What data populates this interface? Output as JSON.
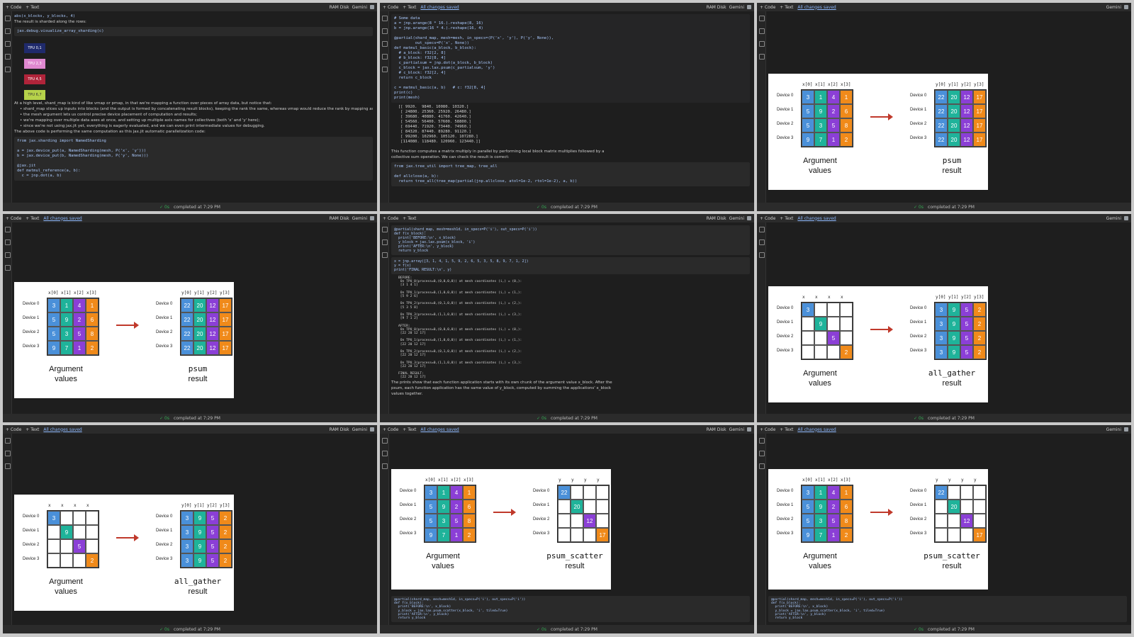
{
  "colors": {
    "blue": "#4a90d9",
    "teal": "#1fb39a",
    "purple": "#8b3fd6",
    "orange": "#f08a1a",
    "arrow": "#c0392b"
  },
  "common": {
    "tab_code": "+ Code",
    "tab_text": "+ Text",
    "link_label": "All changes saved",
    "ram_label": "RAM Disk",
    "gemini_label": "Gemini",
    "status": "completed at 7:29 PM",
    "status_ok": "✓ 0s"
  },
  "device_labels": [
    "Device 0",
    "Device 1",
    "Device 2",
    "Device 3"
  ],
  "x_cols": [
    "x[0]",
    "x[1]",
    "x[2]",
    "x[3]"
  ],
  "y_cols": [
    "y[0]",
    "y[1]",
    "y[2]",
    "y[3]"
  ],
  "x_plain": [
    "x",
    "x",
    "x",
    "x"
  ],
  "y_plain": [
    "y",
    "y",
    "y",
    "y"
  ],
  "arg_matrix": [
    [
      "3",
      "1",
      "4",
      "1"
    ],
    [
      "5",
      "9",
      "2",
      "6"
    ],
    [
      "5",
      "3",
      "5",
      "8"
    ],
    [
      "9",
      "7",
      "1",
      "2"
    ]
  ],
  "psum_matrix": [
    [
      "22",
      "20",
      "12",
      "17"
    ],
    [
      "22",
      "20",
      "12",
      "17"
    ],
    [
      "22",
      "20",
      "12",
      "17"
    ],
    [
      "22",
      "20",
      "12",
      "17"
    ]
  ],
  "gather_arg": [
    [
      "3",
      "",
      "",
      ""
    ],
    [
      "",
      "9",
      "",
      ""
    ],
    [
      "",
      "",
      "5",
      ""
    ],
    [
      "",
      "",
      "",
      "2"
    ]
  ],
  "gather_res": [
    [
      "3",
      "9",
      "5",
      "2"
    ],
    [
      "3",
      "9",
      "5",
      "2"
    ],
    [
      "3",
      "9",
      "5",
      "2"
    ],
    [
      "3",
      "9",
      "5",
      "2"
    ]
  ],
  "scatter_res": [
    [
      "22",
      "",
      "",
      ""
    ],
    [
      "",
      "20",
      "",
      ""
    ],
    [
      "",
      "",
      "12",
      ""
    ],
    [
      "",
      "",
      "",
      "17"
    ]
  ],
  "captions": {
    "argument": "Argument values",
    "psum": "psum result",
    "all_gather": "all_gather result",
    "psum_scatter": "psum_scatter result"
  },
  "panels": {
    "p1": {
      "lines": [
        "abs(x_blocks, y_blocks, 4)",
        "The result is sharded along the rows:",
        "jax.debug.visualize_array_sharding(c)",
        "At a high level, shard_map is kind of like vmap or pmap, in that we're mapping a function over pieces of array data, but notice that:",
        "• shard_map slices up inputs into blocks (and the output is formed by concatenating result blocks), keeping the rank the same, whereas vmap would reduce the rank by mapping away an axis;",
        "• the mesh argument lets us control precise device placement of computation and results;",
        "• we're mapping over multiple data axes at once, and setting up multiple axis names for collectives (both 'x' and 'y' here);",
        "• since we're not using jax.jit yet, everything is eagerly evaluated, and we can even print intermediate values for debugging.",
        "The above code is performing the same computation as this jax.jit automatic parallelization code:"
      ],
      "tpus": [
        "TPU 0,1",
        "TPU 2,3",
        "TPU 4,5",
        "TPU 6,7"
      ],
      "code": "from jax.sharding import NamedSharding\n\na = jax.device_put(a, NamedSharding(mesh, P('x', 'y')))\nb = jax.device_put(b, NamedSharding(mesh, P('y', None)))\n\n@jax.jit\ndef matmul_reference(a, b):\n  c = jnp.dot(a, b)"
    },
    "p2": {
      "code": "# Some data\na = jnp.arange(8 * 16.).reshape(8, 16)\nb = jnp.arange(16 * 4.).reshape(16, 4)\n\n@partial(shard_map, mesh=mesh, in_specs=(P('x', 'y'), P('y', None)),\n         out_specs=P('x', None))\ndef matmul_basic(a_block, b_block):\n  # a_block: f32[2, 8]\n  # b_block: f32[8, 4]\n  c_partialsum = jnp.dot(a_block, b_block)\n  c_block = jax.lax.psum(c_partialsum, 'y')\n  # c_block: f32[2, 4]\n  return c_block\n\nc = matmul_basic(a, b)   # c: f32[8, 4]\nprint(c)\nprint(mesh)",
      "output": "[[ 9920.  9840. 10080. 10320.]\n [ 24800. 25360. 25920. 26480.]\n [ 39680. 40880. 41760. 42640.]\n [ 54560. 56400. 57600. 58800.]\n [ 69440. 71920. 73440. 74960.]\n [ 84320. 87440. 89280. 91120.]\n [ 99200. 102960. 105120. 107280.]\n [114080. 118480. 120960. 123440.]]",
      "lines": [
        "This function computes a matrix multiply in parallel by performing local block matrix multiplies followed by a collective sum operation. We can check the result is correct:"
      ],
      "code2": "from jax.tree_util import tree_map, tree_all\n\ndef allclose(a, b):\n  return tree_all(tree_map(partial(jnp.allclose, atol=1e-2, rtol=1e-2), a, b))"
    },
    "psum_text": [
      "Notice that collective_sum might depend on all the x_blocks. That is, while f_sum1 and f_sum2 are mapped over blocks independently, a collective introduces some amount of cross-block dependence. Physically, that means communication across devices. Exactly what communication happens, and what values are computed, depend on the collective.",
      "psum",
      "The simplest collective may be jax.lax.psum, which computes an all-reduce-sum along a device mesh axis (or multiple axes). Here's a toy example:"
    ],
    "p5": {
      "code": "@partial(shard_map, mesh=mesh1d, in_specs=P('i'), out_specs=P('i'))\ndef f(x_block):\n  print('BEFORE:\\n', x_block)\n  y_block = jax.lax.psum(x_block, 'i')\n  print('AFTER:\\n', y_block)\n  return y_block",
      "code2": "x = jnp.array([3, 1, 4, 1, 5, 9, 2, 6, 5, 3, 5, 8, 9, 7, 1, 2])\ny = f(x)\nprint('FINAL RESULT:\\n', y)",
      "output": "BEFORE:\n On TPU_0(process=0,(0,0,0,0)) at mesh coordinates (i,) = (0,):\n [3 1 4 1]\n\n On TPU_1(process=0,(1,0,0,0)) at mesh coordinates (i,) = (1,):\n [5 9 2 6]\n\n On TPU_2(process=0,(0,1,0,0)) at mesh coordinates (i,) = (2,):\n [5 3 5 8]\n\n On TPU_3(process=0,(1,1,0,0)) at mesh coordinates (i,) = (3,):\n [9 7 1 2]\n\nAFTER:\n On TPU_0(process=0,(0,0,0,0)) at mesh coordinates (i,) = (0,):\n [22 20 12 17]\n\n On TPU_1(process=0,(1,0,0,0)) at mesh coordinates (i,) = (1,):\n [22 20 12 17]\n\n On TPU_2(process=0,(0,1,0,0)) at mesh coordinates (i,) = (2,):\n [22 20 12 17]\n\n On TPU_3(process=0,(1,1,0,0)) at mesh coordinates (i,) = (3,):\n [22 20 12 17]\n\nFINAL RESULT:\n [22 20 12 17]",
      "lines": [
        "The prints show that each function application starts with its own chunk of the argument value x_block. After the psum, each function application has the same value of y_block, computed by summing the applications' x_block values together."
      ]
    },
    "gather_text": [
      "In machine learning, we often use psum to compute total losses or, when we have a grad inside the shard_mapped function body, total gradients.",
      "In the sequel, we'll see how psum can be implemented in terms of other primitives, which gives some intuition about its communication cost.",
      "all_gather",
      "Another fundamental operation is gathering array shards along an axis, so that each function application has a full copy of the data along that axis:"
    ],
    "scatter_text": [
      "In deep learning, we might use all_gather on parameters in fully sharded data parallelism (FSDP).",
      "psum_scatter",
      "The jax.lax.psum_scatter collective is a bit less intuitive. It's like psum except each function instance gets only one shard of the result:"
    ],
    "bottom_code": {
      "import_jax": "[ ] import jax",
      "gather_code": "@partial(shard_map, mesh=mesh1d, in_specs=P('i'), out_specs=P('i'))\ndef f(x_block):",
      "scatter_code": "@partial(shard_map, mesh=mesh1d, in_specs=P('i'), out_specs=P('i'))\ndef f(x_block):\n  print('BEFORE:\\n', x_block)\n  y_block = jax.lax.psum_scatter(x_block, 'i', tiled=True)\n  print('AFTER:\\n', y_block)\n  return y_block"
    }
  }
}
